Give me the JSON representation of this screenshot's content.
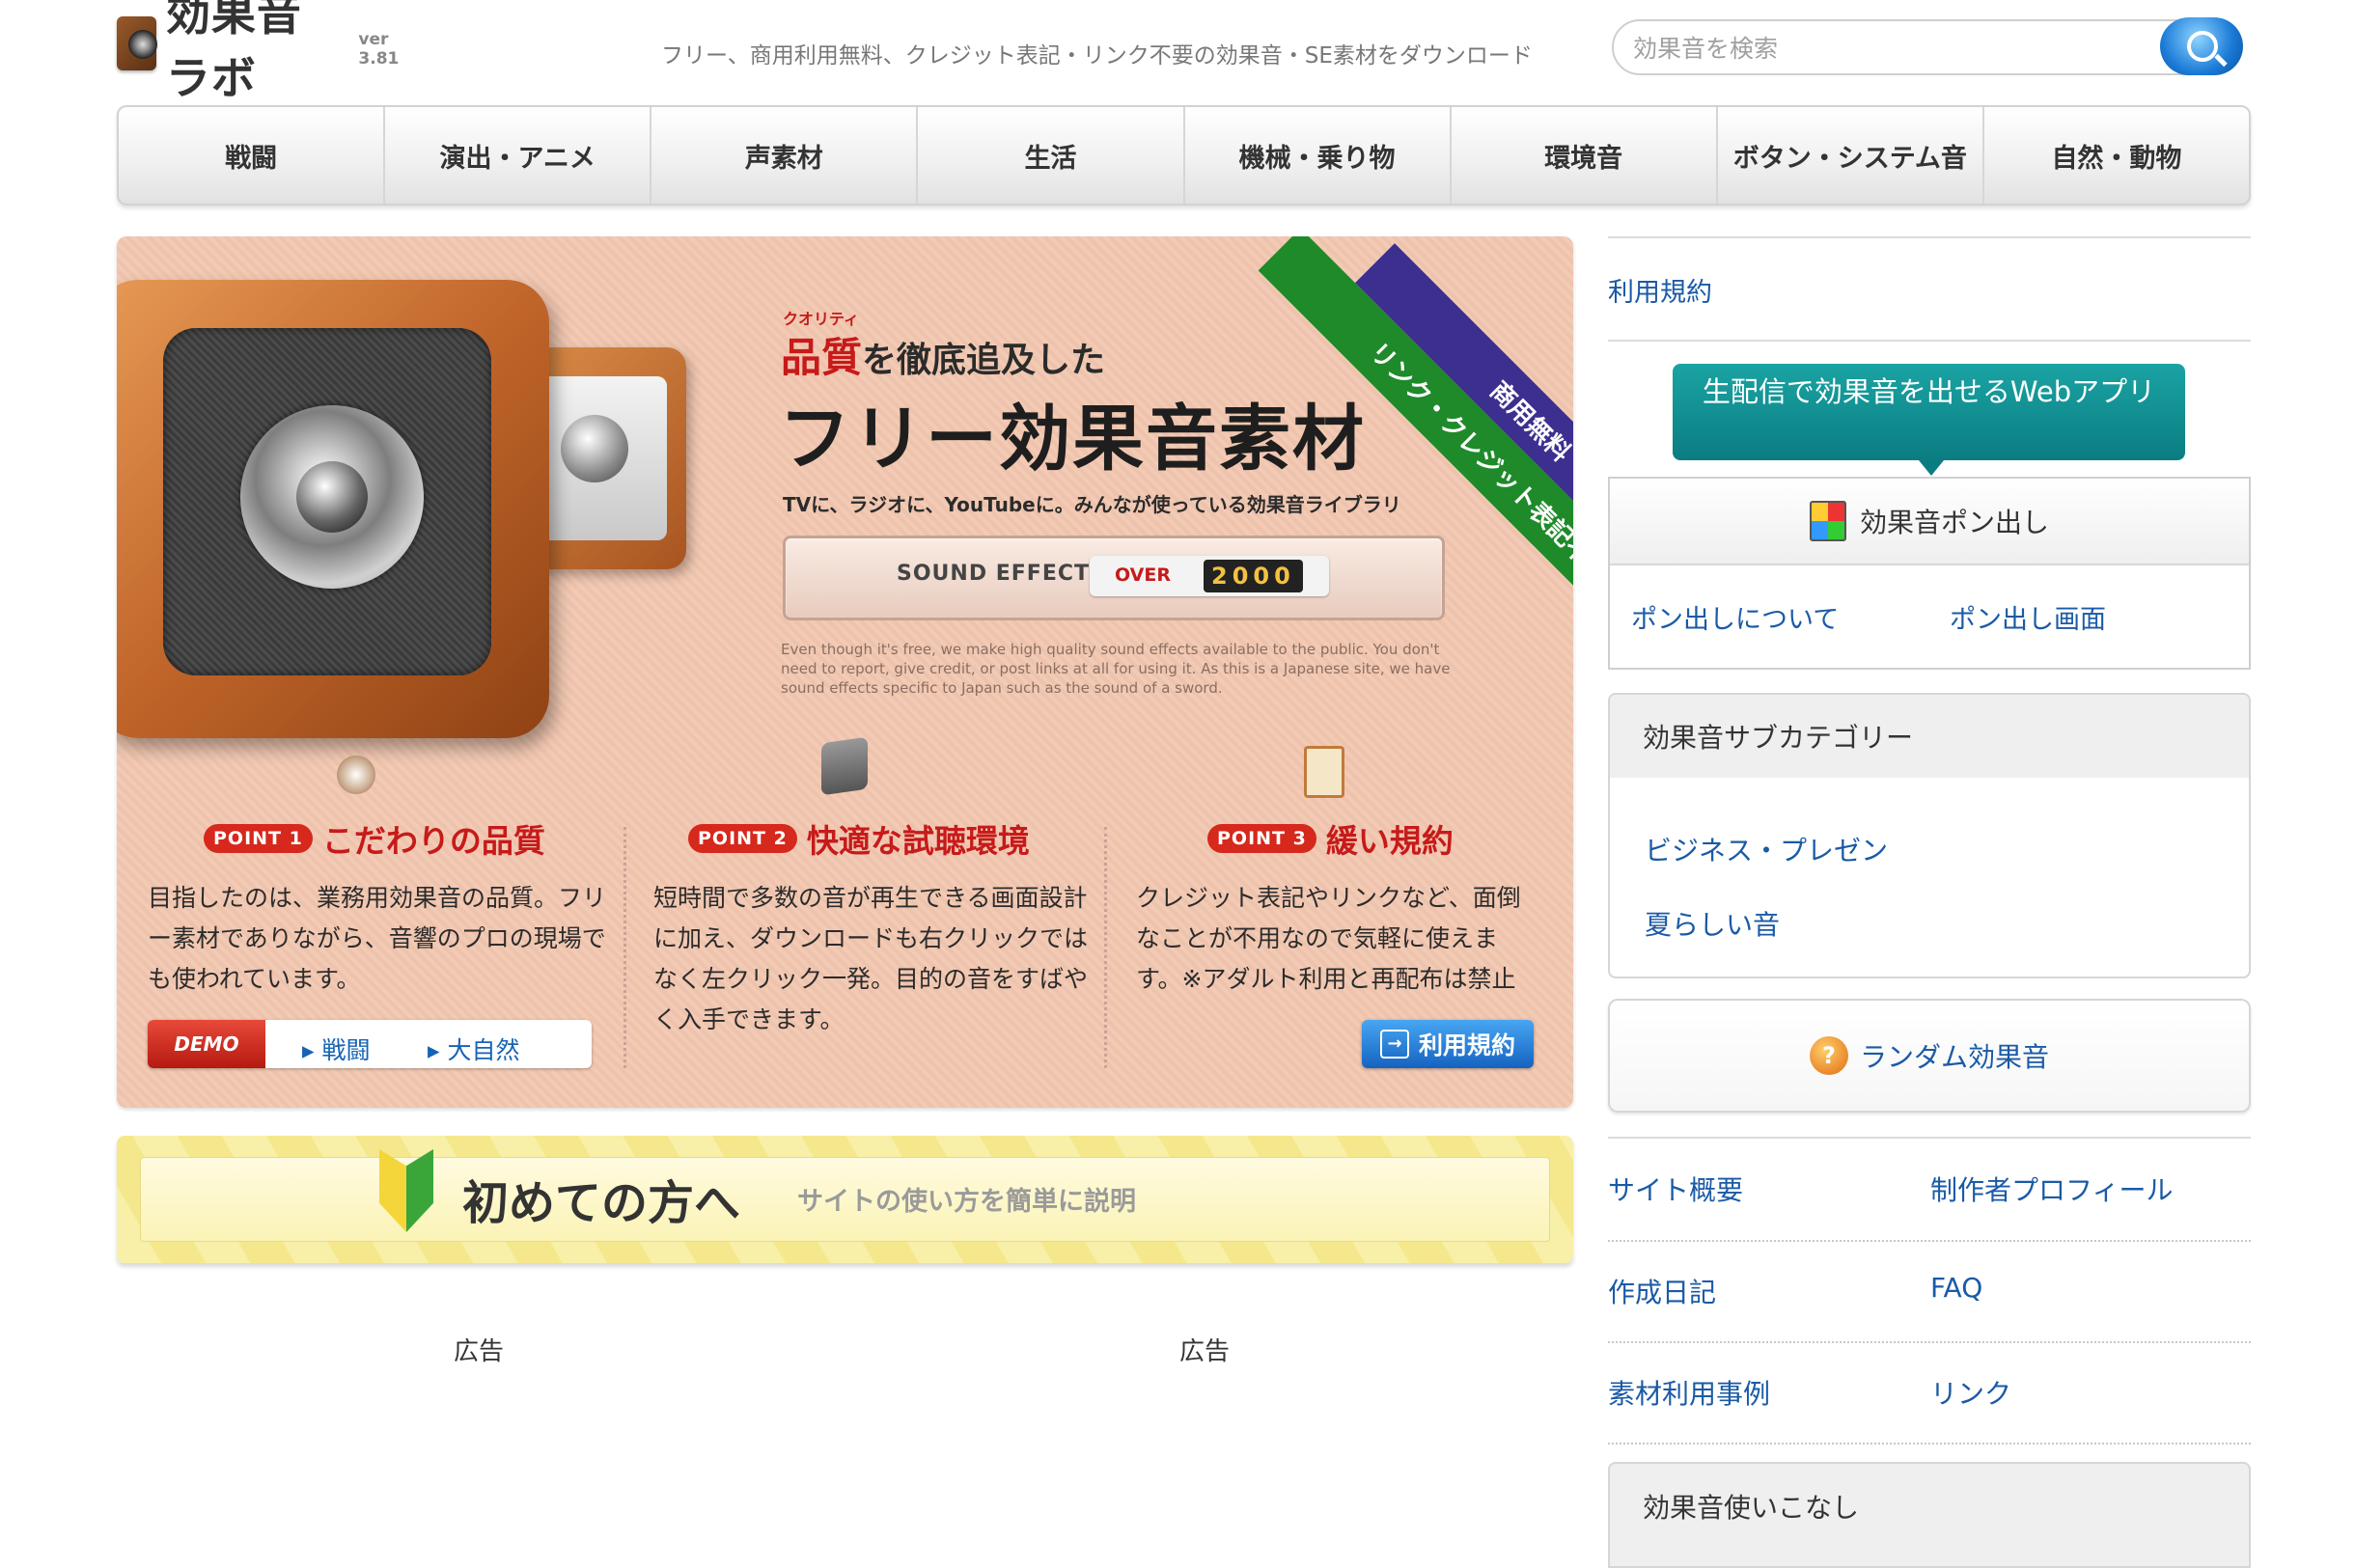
{
  "header": {
    "logo_text": "効果音ラボ",
    "version": "ver 3.81",
    "tagline": "フリー、商用利用無料、クレジット表記・リンク不要の効果音・SE素材をダウンロード",
    "search_placeholder": "効果音を検索"
  },
  "nav": {
    "items": [
      "戦闘",
      "演出・アニメ",
      "声素材",
      "生活",
      "機械・乗り物",
      "環境音",
      "ボタン・システム音",
      "自然・動物"
    ]
  },
  "hero": {
    "ribbon_top": "商用無料",
    "ribbon_bottom": "リンク・クレジット表記不要",
    "ruby": "クオリティ",
    "heading_emph": "品質",
    "heading_small": "を徹底追及した",
    "heading_big": "フリー効果音素材",
    "subline": "TVに、ラジオに、YouTubeに。みんなが使っている効果音ライブラリ",
    "sfx_label": "SOUND EFFECTS",
    "over_label": "OVER",
    "count": "2000",
    "english": "Even though it's free, we make high quality sound effects available to the public. You don't need to report, give credit, or post links at all for using it. As this is a Japanese site, we have sound effects specific to Japan such as the sound of a sword.",
    "points": [
      {
        "badge": "POINT 1",
        "title": "こだわりの品質",
        "text": "目指したのは、業務用効果音の品質。フリー素材でありながら、音響のプロの現場でも使われています。"
      },
      {
        "badge": "POINT 2",
        "title": "快適な試聴環境",
        "text": "短時間で多数の音が再生できる画面設計に加え、ダウンロードも右クリックではなく左クリック一発。目的の音をすばやく入手できます。"
      },
      {
        "badge": "POINT 3",
        "title": "緩い規約",
        "text": "クレジット表記やリンクなど、面倒なことが不用なので気軽に使えます。※アダルト利用と再配布は禁止"
      }
    ],
    "demo_label": "DEMO",
    "demo_links": [
      "戦闘",
      "大自然"
    ],
    "terms_button": "利用規約"
  },
  "beginner": {
    "title": "初めての方へ",
    "subtitle": "サイトの使い方を簡単に説明"
  },
  "ads": [
    "広告",
    "広告"
  ],
  "sidebar": {
    "terms_link": "利用規約",
    "live_button": "生配信で効果音を出せるWebアプリ",
    "pon_title": "効果音ポン出し",
    "pon_links": [
      "ポン出しについて",
      "ポン出し画面"
    ],
    "subcat_title": "効果音サブカテゴリー",
    "subcat_items": [
      "ビジネス・プレゼン",
      "夏らしい音"
    ],
    "random_button": "ランダム効果音",
    "links": [
      "サイト概要",
      "制作者プロフィール",
      "作成日記",
      "FAQ",
      "素材利用事例",
      "リンク"
    ],
    "usage_title": "効果音使いこなし"
  },
  "colors": {
    "link": "#1a5aa6",
    "accent_red": "#c71a1a",
    "live_teal": "#0a7d82",
    "hero_bg": "#f2c7b0"
  }
}
